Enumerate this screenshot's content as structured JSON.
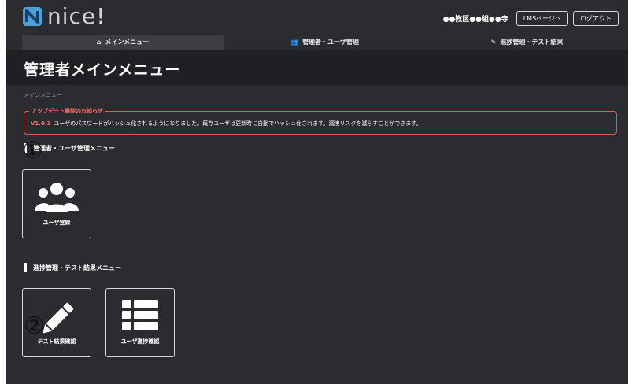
{
  "header": {
    "logo_text": "nice!",
    "school_name": "●●教区●●組●●寺",
    "lms_button": "LMSページへ",
    "logout_button": "ログアウト"
  },
  "nav": {
    "tabs": [
      {
        "label": "メインメニュー",
        "icon": "home-icon"
      },
      {
        "label": "管理者・ユーザ管理",
        "icon": "users-icon"
      },
      {
        "label": "進捗管理・テスト結果",
        "icon": "pencil-icon"
      }
    ]
  },
  "page": {
    "title": "管理者メインメニュー",
    "breadcrumb": "メインメニュー"
  },
  "notice": {
    "legend": "アップデート機能のお知らせ",
    "version": "V1.0.1",
    "text": "ユーザのパスワードがハッシュ化されるようになりました。既存ユーザは更新時に自動でハッシュ化されます。漏洩リスクを減らすことができます。"
  },
  "sections": [
    {
      "title": "管理者・ユーザ管理メニュー",
      "marker": "①",
      "cards": [
        {
          "label": "ユーザ登録",
          "icon": "users-icon"
        }
      ]
    },
    {
      "title": "進捗管理・テスト結果メニュー",
      "marker": "②",
      "cards": [
        {
          "label": "テスト結果確認",
          "icon": "pencil-icon"
        },
        {
          "label": "ユーザ進捗確認",
          "icon": "list-icon"
        }
      ]
    }
  ],
  "colors": {
    "background": "#2b2c30",
    "title_band": "#1f2023",
    "alert": "#e25a5a"
  }
}
